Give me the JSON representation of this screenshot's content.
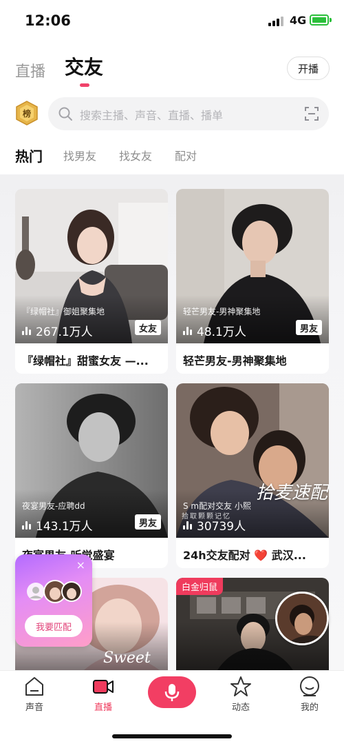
{
  "status_bar": {
    "time": "12:06",
    "network": "4G"
  },
  "top_tabs": {
    "live": "直播",
    "friends": "交友",
    "start_live": "开播"
  },
  "search": {
    "placeholder": "搜索主播、声音、直播、播单",
    "rank_badge": "榜"
  },
  "sub_tabs": [
    "热门",
    "找男友",
    "找女友",
    "配对"
  ],
  "cards": [
    {
      "subtitle": "『绿帽社』御姐聚集地",
      "viewers": "267.1万人",
      "tag": "女友",
      "title": "『绿帽社』甜蜜女友 —..."
    },
    {
      "subtitle": "轻芒男友-男神聚集地",
      "viewers": "48.1万人",
      "tag": "男友",
      "title": "轻芒男友-男神聚集地"
    },
    {
      "subtitle": "夜宴男友-应聘dd",
      "viewers": "143.1万人",
      "tag": "男友",
      "title": "夜宴男友-听觉盛宴"
    },
    {
      "subtitle": "S m配对交友 小熙",
      "viewers": "30739人",
      "overlay": "拾麦速配",
      "overlay_small": "拾取颗颗记忆",
      "title": "24h交友配对 ❤️ 武汉..."
    },
    {
      "overlay": "Sweet"
    },
    {
      "corner_tag": "白金归鼠"
    }
  ],
  "match_widget": {
    "button": "我要匹配",
    "close": "×"
  },
  "bottom_nav": [
    "声音",
    "直播",
    "动态",
    "我的"
  ],
  "colors": {
    "accent": "#f23e63",
    "battery": "#2bbf3b"
  }
}
